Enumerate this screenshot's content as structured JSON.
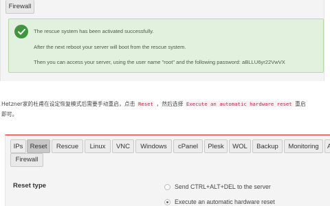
{
  "top_panel": {
    "firewall_label": "Firewall",
    "alert": {
      "icon": "check-circle-icon",
      "lines": [
        "The rescue system has been activated successfully.",
        "After the next reboot your server will boot from the rescue system.",
        "Then you can access your server, using the user name \"root\" and the following password: aBLLU6yr22VwVX"
      ]
    }
  },
  "instruction": {
    "part1": "Hetzner家的杜甫在设定恢复模式后需要手动重启，点击 ",
    "code1": "Reset",
    "part2": " ，然后选择 ",
    "code2": "Execute an automatic hardware reset",
    "part3": " 重启",
    "line2": "即可。"
  },
  "bottom_panel": {
    "tabs": [
      {
        "label": "IPs"
      },
      {
        "label": "Reset",
        "active": true
      },
      {
        "label": "Rescue"
      },
      {
        "label": "Linux"
      },
      {
        "label": "VNC"
      },
      {
        "label": "Windows"
      },
      {
        "label": "cPanel"
      },
      {
        "label": "Plesk"
      },
      {
        "label": "WOL"
      },
      {
        "label": "Backup"
      },
      {
        "label": "Monitoring"
      },
      {
        "label": "A"
      }
    ],
    "firewall_label": "Firewall",
    "reset_type_label": "Reset type",
    "options": [
      {
        "label": "Send CTRL+ALT+DEL to the server",
        "selected": false
      },
      {
        "label": "Execute an automatic hardware reset",
        "selected": true
      }
    ]
  },
  "colors": {
    "accent_red": "#e02a2a",
    "success_green": "#3f963f",
    "alert_bg": "#e2f1de",
    "code_red": "#c7254e"
  }
}
